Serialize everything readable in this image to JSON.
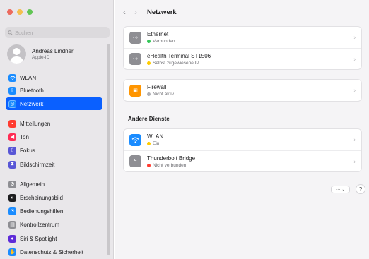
{
  "window": {
    "title": "Netzwerk"
  },
  "sidebar": {
    "search_placeholder": "Suchen",
    "account": {
      "name": "Andreas Lindner",
      "subtitle": "Apple-ID"
    },
    "items": [
      {
        "label": "WLAN",
        "icon": "wifi-icon",
        "color": "#1a8cff"
      },
      {
        "label": "Bluetooth",
        "icon": "bluetooth-icon",
        "color": "#1a8cff"
      },
      {
        "label": "Netzwerk",
        "icon": "globe-icon",
        "color": "#1a8cff",
        "active": true
      },
      {
        "label": "Mitteilungen",
        "icon": "bell-icon",
        "color": "#ff3b30"
      },
      {
        "label": "Ton",
        "icon": "speaker-icon",
        "color": "#ff2d55"
      },
      {
        "label": "Fokus",
        "icon": "moon-icon",
        "color": "#5856d6"
      },
      {
        "label": "Bildschirmzeit",
        "icon": "hourglass-icon",
        "color": "#5856d6"
      },
      {
        "label": "Allgemein",
        "icon": "gear-icon",
        "color": "#8e8e93"
      },
      {
        "label": "Erscheinungsbild",
        "icon": "appearance-icon",
        "color": "#1d1d1f"
      },
      {
        "label": "Bedienungshilfen",
        "icon": "accessibility-icon",
        "color": "#1a8cff"
      },
      {
        "label": "Kontrollzentrum",
        "icon": "control-center-icon",
        "color": "#8e8e93"
      },
      {
        "label": "Siri & Spotlight",
        "icon": "siri-icon",
        "color": "#5e2bd8"
      },
      {
        "label": "Datenschutz & Sicherheit",
        "icon": "hand-icon",
        "color": "#1a8cff"
      }
    ]
  },
  "services": [
    {
      "name": "Ethernet",
      "status": "Verbunden",
      "status_color": "#34c759",
      "icon": "ethernet-icon",
      "icon_color": "#8e8e93"
    },
    {
      "name": "eHealth Terminal ST1506",
      "status": "Selbst zugewiesene IP",
      "status_color": "#ffcc00",
      "icon": "ethernet-icon",
      "icon_color": "#8e8e93"
    }
  ],
  "firewall": {
    "name": "Firewall",
    "status": "Nicht aktiv",
    "status_color": "#b0b0b5",
    "icon": "firewall-icon",
    "icon_color": "#ff9500"
  },
  "other_services": {
    "title": "Andere Dienste",
    "items": [
      {
        "name": "WLAN",
        "status": "Ein",
        "status_color": "#ffcc00",
        "icon": "wifi-icon",
        "icon_color": "#1a8cff"
      },
      {
        "name": "Thunderbolt Bridge",
        "status": "Nicht verbunden",
        "status_color": "#ff3b30",
        "icon": "thunderbolt-icon",
        "icon_color": "#8e8e93"
      }
    ]
  },
  "footer": {
    "more_label": "···",
    "help_label": "?"
  }
}
